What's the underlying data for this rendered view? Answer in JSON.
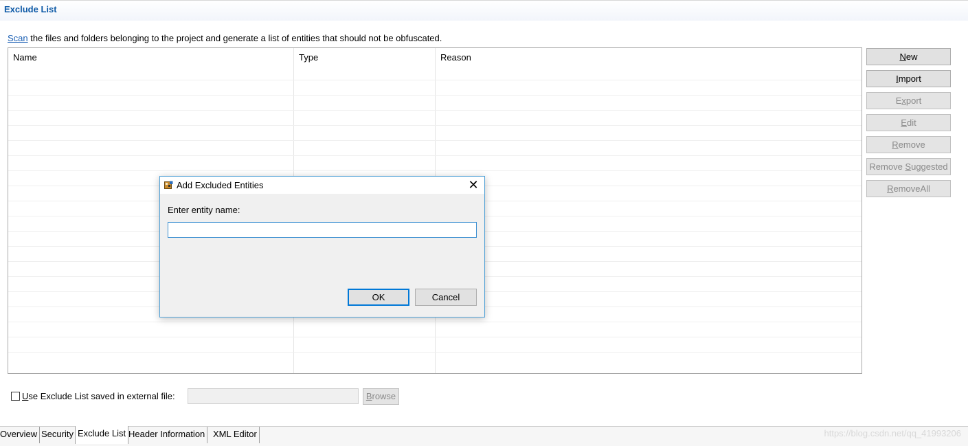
{
  "header": {
    "title": "Exclude List"
  },
  "description": {
    "link": "Scan",
    "text": " the files and folders belonging to the project and generate a list of entities that should not be obfuscated."
  },
  "table": {
    "columns": [
      "Name",
      "Type",
      "Reason"
    ]
  },
  "side_buttons": {
    "new": {
      "accel": "N",
      "rest": "ew",
      "enabled": true
    },
    "import": {
      "accel": "I",
      "rest": "mport",
      "enabled": true
    },
    "export": {
      "pre": "E",
      "accel": "x",
      "rest": "port",
      "enabled": false
    },
    "edit": {
      "accel": "E",
      "rest": "dit",
      "enabled": false
    },
    "remove": {
      "accel": "R",
      "rest": "emove",
      "enabled": false
    },
    "remove_suggested": {
      "pre": "Remove ",
      "accel": "S",
      "rest": "uggested",
      "enabled": false
    },
    "remove_all": {
      "accel": "R",
      "rest": "emoveAll",
      "enabled": false
    }
  },
  "external": {
    "checkbox_accel": "U",
    "checkbox_rest": "se Exclude List saved in external file:",
    "checked": false,
    "input_value": "",
    "browse_accel": "B",
    "browse_rest": "rowse"
  },
  "tabs": [
    {
      "label": "Overview",
      "active": false
    },
    {
      "label": "Security",
      "active": false
    },
    {
      "label": "Exclude List",
      "active": true
    },
    {
      "label": "Header Information",
      "active": false
    },
    {
      "label": "XML Editor",
      "active": false
    }
  ],
  "watermark": "https://blog.csdn.net/qq_41993206",
  "dialog": {
    "title": "Add Excluded Entities",
    "close_icon": "close-icon",
    "prompt": "Enter entity name:",
    "input_value": "",
    "ok_label": "OK",
    "cancel_label": "Cancel"
  },
  "colors": {
    "header_title": "#0e5aa7",
    "link": "#1a5fb4",
    "dialog_border": "#4fa0d6",
    "focus_border": "#0078d7"
  }
}
